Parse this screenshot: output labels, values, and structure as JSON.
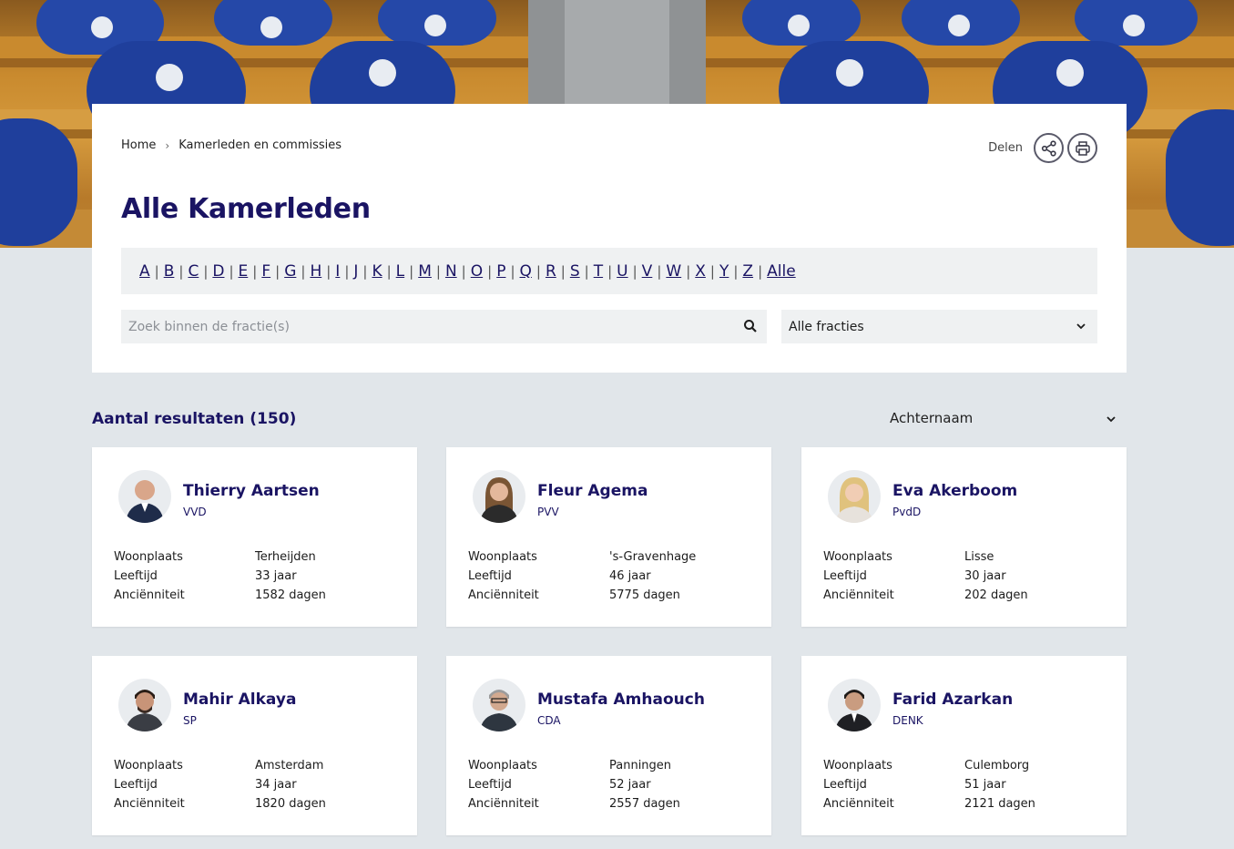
{
  "breadcrumb": {
    "home": "Home",
    "current": "Kamerleden en commissies"
  },
  "share": {
    "label": "Delen"
  },
  "page_title": "Alle Kamerleden",
  "alphabet": [
    "A",
    "B",
    "C",
    "D",
    "E",
    "F",
    "G",
    "H",
    "I",
    "J",
    "K",
    "L",
    "M",
    "N",
    "O",
    "P",
    "Q",
    "R",
    "S",
    "T",
    "U",
    "V",
    "W",
    "X",
    "Y",
    "Z",
    "Alle"
  ],
  "search": {
    "placeholder": "Zoek binnen de fractie(s)",
    "value": ""
  },
  "filter": {
    "selected": "Alle fracties"
  },
  "results": {
    "label": "Aantal resultaten (150)"
  },
  "sort": {
    "selected": "Achternaam"
  },
  "labels": {
    "woonplaats": "Woonplaats",
    "leeftijd": "Leeftijd",
    "anciënniteit": "Anciënniteit"
  },
  "members": [
    {
      "name": "Thierry Aartsen",
      "party": "VVD",
      "woonplaats": "Terheijden",
      "leeftijd": "33 jaar",
      "anciënniteit": "1582 dagen"
    },
    {
      "name": "Fleur Agema",
      "party": "PVV",
      "woonplaats": "'s-Gravenhage",
      "leeftijd": "46 jaar",
      "anciënniteit": "5775 dagen"
    },
    {
      "name": "Eva Akerboom",
      "party": "PvdD",
      "woonplaats": "Lisse",
      "leeftijd": "30 jaar",
      "anciënniteit": "202 dagen"
    },
    {
      "name": "Mahir Alkaya",
      "party": "SP",
      "woonplaats": "Amsterdam",
      "leeftijd": "34 jaar",
      "anciënniteit": "1820 dagen"
    },
    {
      "name": "Mustafa Amhaouch",
      "party": "CDA",
      "woonplaats": "Panningen",
      "leeftijd": "52 jaar",
      "anciënniteit": "2557 dagen"
    },
    {
      "name": "Farid Azarkan",
      "party": "DENK",
      "woonplaats": "Culemborg",
      "leeftijd": "51 jaar",
      "anciënniteit": "2121 dagen"
    }
  ],
  "colors": {
    "primary": "#1a1463",
    "background": "#e1e6ea",
    "field": "#eff1f2"
  },
  "icons": {
    "share": "share-icon",
    "print": "printer-icon",
    "search": "search-icon",
    "dropdown": "chevron-down-icon"
  }
}
